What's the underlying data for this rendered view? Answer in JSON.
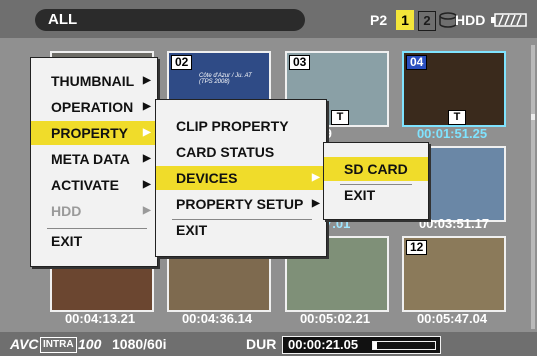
{
  "topbar": {
    "mode_label": "ALL",
    "slot_label": "P2",
    "slot_1": "1",
    "slot_2": "2",
    "hdd_label": "HDD"
  },
  "thumbnails": [
    {
      "number": "",
      "time": "",
      "badge": ""
    },
    {
      "number": "02",
      "time": "",
      "badge": "",
      "caption": "Côte d'Azur / Ju. AT (TPS 2008)"
    },
    {
      "number": "03",
      "time": ":30.09",
      "badge": "T"
    },
    {
      "number": "04",
      "time": "00:01:51.25",
      "badge": "T",
      "selected": true
    },
    {
      "number": "",
      "time": ""
    },
    {
      "number": "",
      "time": ""
    },
    {
      "number": "",
      "time": "7.01"
    },
    {
      "number": "",
      "time": "00:03:51.17"
    },
    {
      "number": "",
      "time": "00:04:13.21"
    },
    {
      "number": "",
      "time": "00:04:36.14"
    },
    {
      "number": "",
      "time": "00:05:02.21"
    },
    {
      "number": "12",
      "time": "00:05:47.04"
    }
  ],
  "menu_main": {
    "items": [
      {
        "label": "THUMBNAIL",
        "arrow": "▶"
      },
      {
        "label": "OPERATION",
        "arrow": "▶"
      },
      {
        "label": "PROPERTY",
        "arrow": "▶",
        "highlighted": true
      },
      {
        "label": "META DATA",
        "arrow": "▶"
      },
      {
        "label": "ACTIVATE",
        "arrow": "▶"
      },
      {
        "label": "HDD",
        "arrow": "▶",
        "disabled": true
      },
      {
        "label": "EXIT",
        "arrow": ""
      }
    ]
  },
  "menu_property": {
    "items": [
      {
        "label": "CLIP PROPERTY",
        "arrow": ""
      },
      {
        "label": "CARD STATUS",
        "arrow": ""
      },
      {
        "label": "DEVICES",
        "arrow": "▶",
        "highlighted": true
      },
      {
        "label": "PROPERTY SETUP",
        "arrow": "▶"
      },
      {
        "label": "EXIT",
        "arrow": ""
      }
    ]
  },
  "menu_devices": {
    "items": [
      {
        "label": "SD CARD",
        "highlighted": true
      },
      {
        "label": "EXIT"
      }
    ]
  },
  "bottombar": {
    "codec": "AVC",
    "codec_intra": "INTRA",
    "codec_rate": "100",
    "format": "1080/60i",
    "dur_label": "DUR",
    "dur_value": "00:00:21.05",
    "dur_progress_fraction": 0.06
  },
  "colors": {
    "highlight": "#f0dc2a",
    "selected_border": "#7fe3ff",
    "menu_bg": "#f2f2f2"
  }
}
